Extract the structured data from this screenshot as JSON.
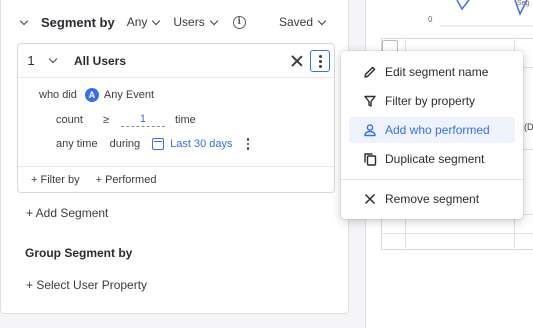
{
  "segment_header": {
    "title": "Segment by",
    "any_dropdown": "Any",
    "users_dropdown": "Users",
    "saved_dropdown": "Saved"
  },
  "segment": {
    "number": "1",
    "name": "All Users",
    "who_did_label": "who did",
    "event": "Any Event",
    "count_label": "count",
    "operator": "≥",
    "count_value": "1",
    "time_label": "time",
    "any_time_label": "any time",
    "during_label": "during",
    "date_range": "Last 30 days",
    "filter_by": "+ Filter by",
    "performed": "+ Performed"
  },
  "add_segment": "+ Add Segment",
  "group_segment_title": "Group Segment by",
  "select_user_property": "+ Select User Property",
  "chart": {
    "zero_label": "0",
    "corner_text": "Seg",
    "table_fragment": "(D"
  },
  "menu": {
    "items": [
      {
        "label": "Edit segment name",
        "icon": "pencil-icon"
      },
      {
        "label": "Filter by property",
        "icon": "filter-icon"
      },
      {
        "label": "Add who performed",
        "icon": "person-icon",
        "active": true
      },
      {
        "label": "Duplicate segment",
        "icon": "duplicate-icon"
      },
      {
        "label": "Remove segment",
        "icon": "close-icon"
      }
    ]
  },
  "colors": {
    "accent": "#3a6ee8",
    "active_bg": "#eef3fd",
    "text": "#2b2b33"
  }
}
